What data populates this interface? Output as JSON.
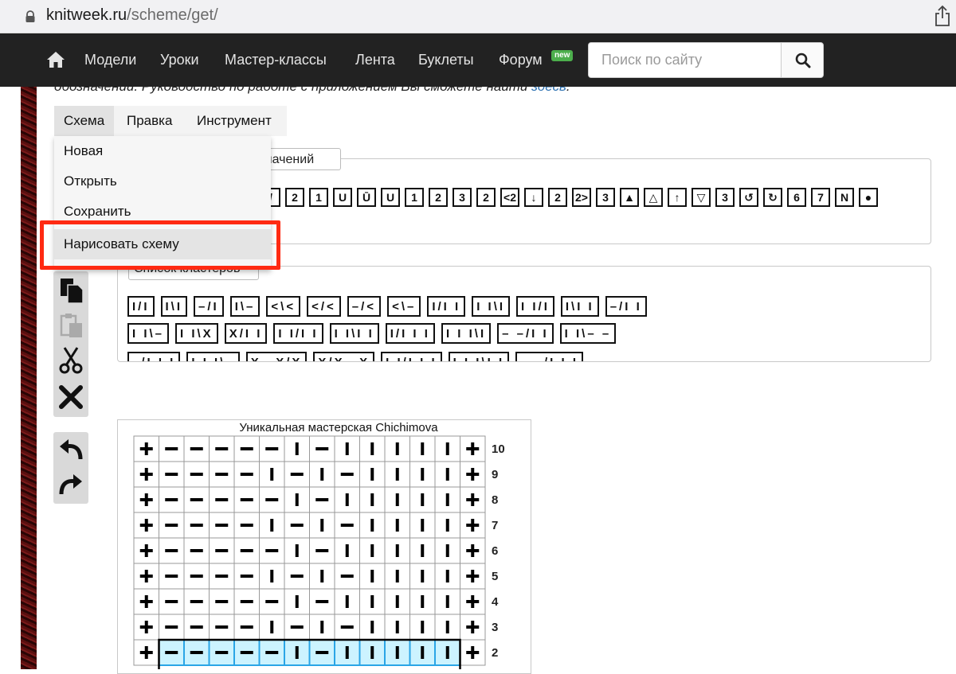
{
  "browser": {
    "url_host": "knitweek.ru",
    "url_path": "/scheme/get/"
  },
  "nav": {
    "links": [
      "Модели",
      "Уроки",
      "Мастер-классы",
      "Лента",
      "Буклеты",
      "Форум"
    ],
    "badge": "new",
    "search_placeholder": "Поиск по сайту"
  },
  "page": {
    "cut_text": "обозначений. Руководство по работе с приложением Вы сможете найти",
    "cut_link": "здесь",
    "cut_end": "."
  },
  "menu": {
    "items": [
      "Схема",
      "Правка",
      "Инструмент"
    ],
    "dropdown": [
      "Новая",
      "Открыть",
      "Сохранить",
      "Нарисовать схему"
    ]
  },
  "symbols_panel": {
    "legend": "Список обозначений",
    "symbols": [
      "/",
      "2",
      "1",
      "U",
      "Ū",
      "U",
      "1",
      "2",
      "3",
      "2",
      "<2",
      "↓",
      "2",
      "2>",
      "3",
      "▲",
      "△",
      "↑",
      "▽",
      "3",
      "↺",
      "↻",
      "6",
      "7",
      "N",
      "●"
    ]
  },
  "clusters_panel": {
    "legend": "Список кластеров",
    "rows": [
      [
        "I/I",
        "I\\I",
        "–/I",
        "I\\–",
        "<\\<",
        "</<",
        "–/<",
        "<\\–",
        "I/I I",
        "I I\\I",
        "I I/I",
        "I\\I I",
        "–/I I"
      ],
      [
        "I I\\–",
        "I I\\X",
        "X/I I",
        "I I/I I",
        "I I\\I I",
        "I/I I I",
        "I I I\\I",
        "– –/I I",
        "I I\\– –"
      ],
      [
        "–/I I I",
        "I I I\\–",
        "X– X/X",
        "X/X –X",
        "I I/I I I",
        "I I I\\I I",
        "– –/I I I"
      ]
    ]
  },
  "chart_data": {
    "type": "table",
    "title": "Уникальная мастерская Chichimova",
    "row_labels": [
      "10",
      "9",
      "8",
      "7",
      "6",
      "5",
      "4",
      "3",
      "2"
    ],
    "rows": [
      [
        "+",
        "–",
        "–",
        "–",
        "–",
        "–",
        "I",
        "–",
        "I",
        "I",
        "I",
        "I",
        "I",
        "+"
      ],
      [
        "+",
        "–",
        "–",
        "–",
        "–",
        "I",
        "–",
        "I",
        "–",
        "I",
        "I",
        "I",
        "I",
        "+"
      ],
      [
        "+",
        "–",
        "–",
        "–",
        "–",
        "–",
        "I",
        "–",
        "I",
        "I",
        "I",
        "I",
        "I",
        "+"
      ],
      [
        "+",
        "–",
        "–",
        "–",
        "–",
        "I",
        "–",
        "I",
        "–",
        "I",
        "I",
        "I",
        "I",
        "+"
      ],
      [
        "+",
        "–",
        "–",
        "–",
        "–",
        "–",
        "I",
        "–",
        "I",
        "I",
        "I",
        "I",
        "I",
        "+"
      ],
      [
        "+",
        "–",
        "–",
        "–",
        "–",
        "I",
        "–",
        "I",
        "–",
        "I",
        "I",
        "I",
        "I",
        "+"
      ],
      [
        "+",
        "–",
        "–",
        "–",
        "–",
        "–",
        "I",
        "–",
        "I",
        "I",
        "I",
        "I",
        "I",
        "+"
      ],
      [
        "+",
        "–",
        "–",
        "–",
        "–",
        "I",
        "–",
        "I",
        "–",
        "I",
        "I",
        "I",
        "I",
        "+"
      ],
      [
        "+",
        "–",
        "–",
        "–",
        "–",
        "–",
        "I",
        "–",
        "I",
        "I",
        "I",
        "I",
        "I",
        "+"
      ]
    ],
    "selected_rows": [
      8
    ],
    "selected_cols": [
      1,
      12
    ]
  },
  "colors": {
    "nav_bg": "#222222",
    "highlight": "#ff2a12",
    "selection": "#ccf3ff",
    "selection_grid": "#2aa5e6"
  }
}
